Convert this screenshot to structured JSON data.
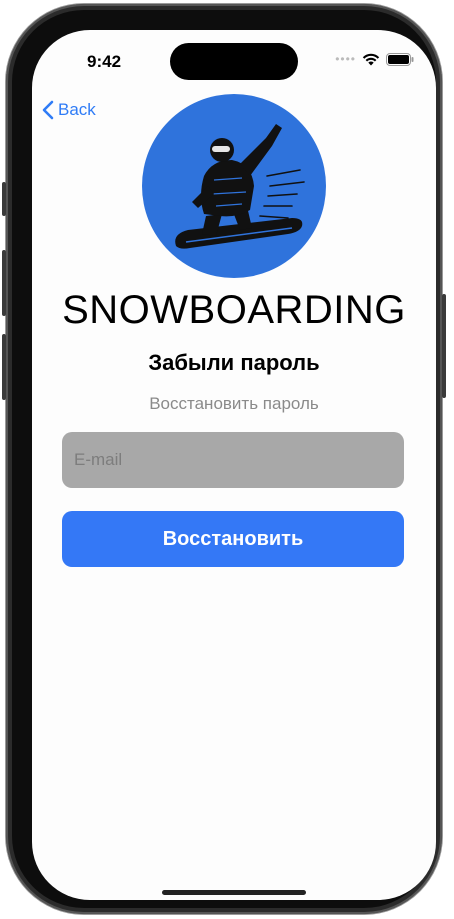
{
  "status_bar": {
    "time": "9:42",
    "icons": [
      "cellular-dots-icon",
      "wifi-icon",
      "battery-icon"
    ]
  },
  "nav": {
    "back_label": "Back",
    "back_icon": "chevron-left-icon"
  },
  "logo": {
    "brand": "SNOWBOARDING",
    "icon": "snowboarder-icon",
    "circle_color": "#2f73dc"
  },
  "screen": {
    "title": "Забыли пароль",
    "subtitle": "Восстановить пароль"
  },
  "form": {
    "email": {
      "placeholder": "E-mail",
      "value": ""
    },
    "submit_label": "Восстановить"
  },
  "colors": {
    "accent": "#3478f6",
    "field_bg": "#a8a8a8",
    "subtitle": "#8a8a8a"
  }
}
